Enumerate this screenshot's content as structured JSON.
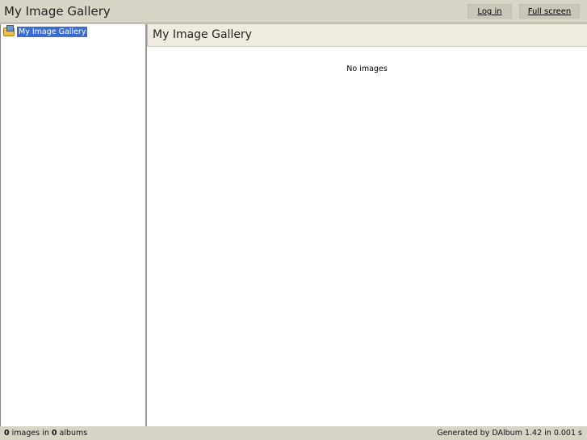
{
  "header": {
    "title": "My Image Gallery",
    "login": "Log in",
    "fullscreen": "Full screen"
  },
  "tree": {
    "root": "My Image Gallery"
  },
  "main": {
    "title": "My Image Gallery",
    "empty": "No images"
  },
  "status": {
    "images": "0",
    "images_label": " images in ",
    "albums": "0",
    "albums_label": " albums",
    "generated": "Generated by DAlbum 1.42 in 0.001 s"
  }
}
